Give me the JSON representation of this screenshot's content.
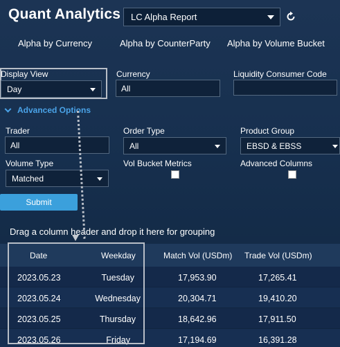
{
  "app": {
    "title": "Quant Analytics"
  },
  "report": {
    "selected": "LC Alpha Report"
  },
  "tabs": [
    "Alpha by Currency",
    "Alpha by CounterParty",
    "Alpha by Volume Bucket"
  ],
  "filters": {
    "display_view": {
      "label": "Display View",
      "value": "Day"
    },
    "currency": {
      "label": "Currency",
      "value": "All"
    },
    "liquidity_consumer_code": {
      "label": "Liquidity Consumer Code",
      "value": ""
    },
    "advanced_options_label": "Advanced Options",
    "trader": {
      "label": "Trader",
      "value": "All"
    },
    "order_type": {
      "label": "Order Type",
      "value": "All"
    },
    "product_group": {
      "label": "Product Group",
      "value": "EBSD & EBSS"
    },
    "volume_type": {
      "label": "Volume Type",
      "value": "Matched"
    },
    "vol_bucket_metrics": {
      "label": "Vol Bucket Metrics",
      "checked": false
    },
    "advanced_columns": {
      "label": "Advanced Columns",
      "checked": false
    },
    "submit_label": "Submit"
  },
  "grouping_hint": "Drag a column header and drop it here for grouping",
  "grid": {
    "columns": [
      "Date",
      "Weekday",
      "Match Vol (USDm)",
      "Trade Vol (USDm)"
    ],
    "rows": [
      [
        "2023.05.23",
        "Tuesday",
        "17,953.90",
        "17,265.41"
      ],
      [
        "2023.05.24",
        "Wednesday",
        "20,304.71",
        "19,410.20"
      ],
      [
        "2023.05.25",
        "Thursday",
        "18,642.96",
        "17,911.50"
      ],
      [
        "2023.05.26",
        "Friday",
        "17,194.69",
        "16,391.28"
      ]
    ]
  },
  "colors": {
    "accent": "#4aa3e8",
    "button": "#3ba0dc",
    "background": "#17304f"
  }
}
